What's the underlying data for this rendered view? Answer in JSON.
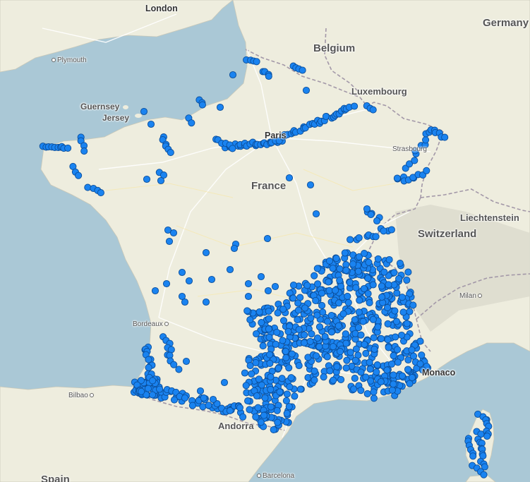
{
  "colors": {
    "sea": "#aac8d6",
    "land": "#eeedde",
    "land_shade": "#e3e6d0",
    "alps": "#d9d8cc",
    "marker_fill": "#1a83f0",
    "marker_stroke": "#0b4e9a",
    "border": "#a398a8",
    "road": "#ffffff"
  },
  "map": {
    "labels": {
      "countries": [
        {
          "id": "belgium",
          "text": "Belgium"
        },
        {
          "id": "luxembourg",
          "text": "Luxembourg"
        },
        {
          "id": "germany",
          "text": "Germany"
        },
        {
          "id": "france",
          "text": "France"
        },
        {
          "id": "switzerland",
          "text": "Switzerland"
        },
        {
          "id": "liechtenstein",
          "text": "Liechtenstein"
        },
        {
          "id": "guernsey",
          "text": "Guernsey"
        },
        {
          "id": "jersey",
          "text": "Jersey"
        },
        {
          "id": "spain",
          "text": "Spain"
        },
        {
          "id": "andorra",
          "text": "Andorra"
        }
      ],
      "capitals": [
        {
          "id": "london",
          "text": "London"
        },
        {
          "id": "paris",
          "text": "Paris"
        },
        {
          "id": "monaco",
          "text": "Monaco"
        }
      ],
      "cities": [
        {
          "id": "plymouth",
          "text": "Plymouth"
        },
        {
          "id": "strasbourg",
          "text": "Strasbourg"
        },
        {
          "id": "milan",
          "text": "Milan"
        },
        {
          "id": "bordeaux",
          "text": "Bordeaux"
        },
        {
          "id": "bilbao",
          "text": "Bilbao"
        },
        {
          "id": "barcelona",
          "text": "Barcelona"
        }
      ]
    }
  }
}
